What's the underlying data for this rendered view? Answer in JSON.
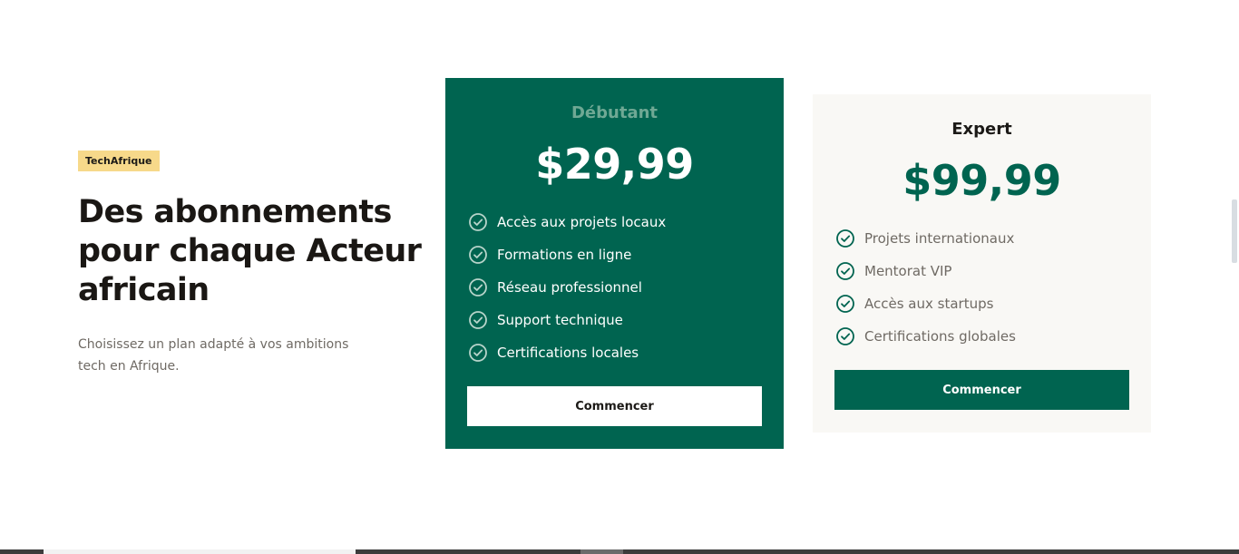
{
  "intro": {
    "tag": "TechAfrique",
    "headline": "Des abonnements pour chaque Acteur africain",
    "subtitle": "Choisissez un plan adapté à vos ambitions tech en Afrique."
  },
  "plans": [
    {
      "name": "Débutant",
      "price": "$29,99",
      "features": [
        "Accès aux projets locaux",
        "Formations en ligne",
        "Réseau professionnel",
        "Support technique",
        "Certifications locales"
      ],
      "cta": "Commencer",
      "style": "featured"
    },
    {
      "name": "Expert",
      "price": "$99,99",
      "features": [
        "Projets internationaux",
        "Mentorat VIP",
        "Accès aux startups",
        "Certifications globales"
      ],
      "cta": "Commencer",
      "style": "light"
    }
  ],
  "icons": {
    "feature": "check-circle-icon"
  },
  "colors": {
    "brand_green": "#006450",
    "tag_yellow": "#f7d98a",
    "featured_name": "#6fa894",
    "muted_text": "#6f6a64",
    "expert_card_bg": "#f9f8f5"
  }
}
